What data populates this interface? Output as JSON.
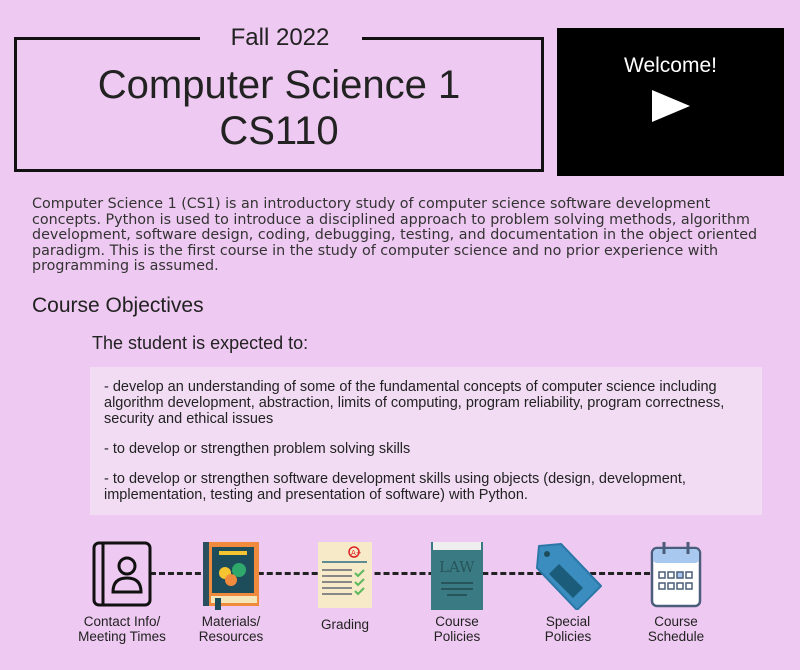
{
  "header": {
    "term": "Fall 2022",
    "title_line1": "Computer Science 1",
    "title_line2": "CS110"
  },
  "video": {
    "label": "Welcome!"
  },
  "description": "Computer Science 1 (CS1) is an introductory study of computer science software development concepts. Python is used to introduce a disciplined approach to problem solving methods, algorithm development, software design, coding, debugging, testing, and documentation in the object oriented paradigm.  This is the first course in the study of computer science and no prior experience with programming is assumed.",
  "objectives": {
    "heading": "Course Objectives",
    "intro": "The student is expected to:",
    "items": [
      "-  develop an understanding of some of the fundamental concepts of computer science including algorithm development, abstraction, limits of computing, program reliability, program correctness, security and ethical issues",
      "-  to develop or strengthen problem solving skills",
      "-  to develop or strengthen software development skills using objects (design, development, implementation, testing and presentation of software) with Python."
    ]
  },
  "nav": [
    {
      "l1": "Contact Info/",
      "l2": "Meeting Times"
    },
    {
      "l1": "Materials/",
      "l2": "Resources"
    },
    {
      "l1": "Grading",
      "l2": ""
    },
    {
      "l1": "Course",
      "l2": "Policies"
    },
    {
      "l1": "Special",
      "l2": "Policies"
    },
    {
      "l1": "Course",
      "l2": "Schedule"
    }
  ],
  "law_text": "LAW",
  "grade_text": "A+"
}
